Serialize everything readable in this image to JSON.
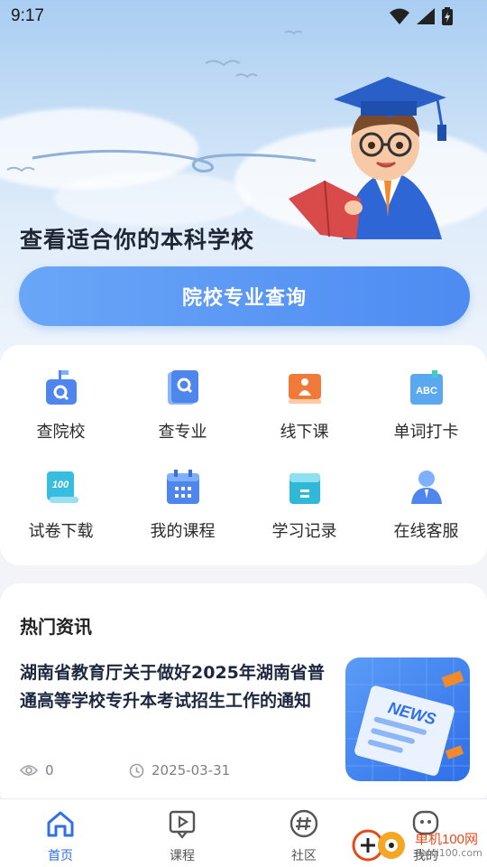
{
  "status_bar": {
    "time": "9:17"
  },
  "hero": {
    "title": "查看适合你的本科学校",
    "query_button": "院校专业查询"
  },
  "shortcuts": [
    {
      "label": "查院校",
      "icon": "school-search-icon"
    },
    {
      "label": "查专业",
      "icon": "major-search-icon"
    },
    {
      "label": "线下课",
      "icon": "offline-class-icon"
    },
    {
      "label": "单词打卡",
      "icon": "abc-word-icon"
    },
    {
      "label": "试卷下载",
      "icon": "exam-paper-icon"
    },
    {
      "label": "我的课程",
      "icon": "calendar-course-icon"
    },
    {
      "label": "学习记录",
      "icon": "study-record-icon"
    },
    {
      "label": "在线客服",
      "icon": "customer-service-icon"
    }
  ],
  "news": {
    "heading": "热门资讯",
    "items": [
      {
        "title": "湖南省教育厅关于做好2025年湖南省普通高等学校专升本考试招生工作的通知",
        "views": "0",
        "date": "2025-03-31",
        "thumb_text": "NEWS"
      }
    ]
  },
  "tabbar": {
    "tabs": [
      {
        "label": "首页",
        "active": true
      },
      {
        "label": "课程",
        "active": false
      },
      {
        "label": "社区",
        "active": false
      },
      {
        "label": "我的",
        "active": false
      }
    ]
  },
  "watermark": {
    "brand": "单机100网",
    "url": "danji100.com"
  },
  "colors": {
    "accent": "#2f6fe8",
    "button": "#5b97f4"
  }
}
